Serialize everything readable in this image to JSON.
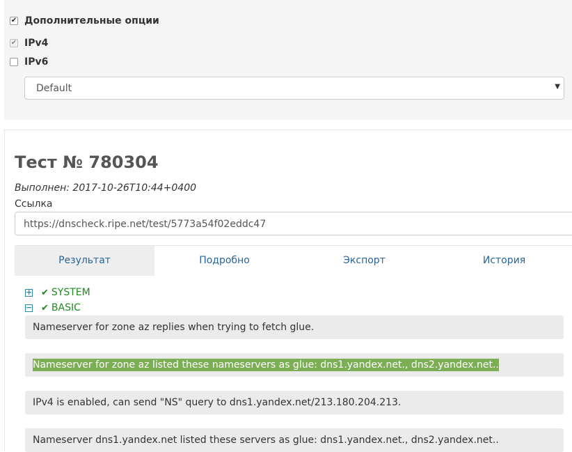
{
  "options": {
    "additional_label": "Дополнительные опции",
    "ipv4_label": "IPv4",
    "ipv6_label": "IPv6",
    "profile_select_value": "Default"
  },
  "test": {
    "title": "Тест № 780304",
    "executed": "Выполнен: 2017-10-26T10:44+0400",
    "link_label": "Ссылка",
    "link_value": "https://dnscheck.ripe.net/test/5773a54f02eddc47"
  },
  "tabs": [
    {
      "label": "Результат",
      "active": true
    },
    {
      "label": "Подробно",
      "active": false
    },
    {
      "label": "Экспорт",
      "active": false
    },
    {
      "label": "История",
      "active": false
    }
  ],
  "tree": {
    "system": {
      "label": "SYSTEM",
      "expander": "⊞"
    },
    "basic": {
      "label": "BASIC",
      "expander": "⊟"
    }
  },
  "messages": [
    "Nameserver for zone az replies when trying to fetch glue.",
    "Nameserver for zone az listed these nameservers as glue: dns1.yandex.net., dns2.yandex.net..",
    "IPv4 is enabled, can send \"NS\" query to dns1.yandex.net/213.180.204.213.",
    "Nameserver dns1.yandex.net listed these servers as glue: dns1.yandex.net., dns2.yandex.net.."
  ],
  "colors": {
    "highlight": "#7cae56",
    "status_ok": "#1f8a1f",
    "tab_link": "#2a6496"
  }
}
